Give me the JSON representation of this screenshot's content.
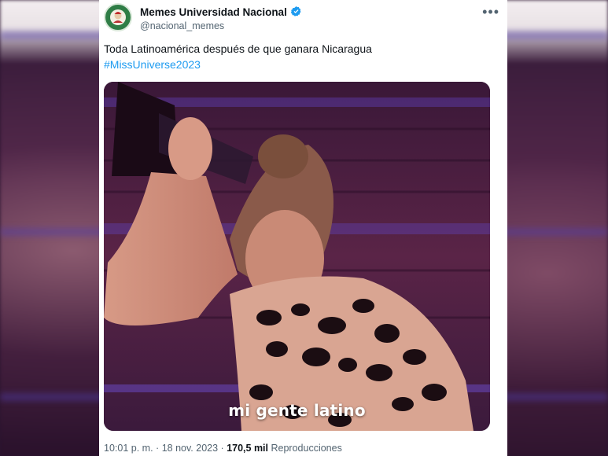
{
  "account": {
    "display_name": "Memes Universidad Nacional",
    "handle": "@nacional_memes",
    "verified_badge_icon": "verified-badge-icon",
    "more_icon": "more-options-icon"
  },
  "tweet": {
    "text": "Toda Latinoamérica después de que ganara Nicaragua",
    "hashtag": "#MissUniverse2023",
    "media_caption": "mi gente latino",
    "time": "10:01 p. m.",
    "date": "18 nov. 2023",
    "separator": "·",
    "views_count": "170,5 mil",
    "views_label": "Reproducciones"
  },
  "colors": {
    "link": "#1d9bf0",
    "verified": "#1d9bf0",
    "text_primary": "#0f1419",
    "text_secondary": "#536471"
  }
}
